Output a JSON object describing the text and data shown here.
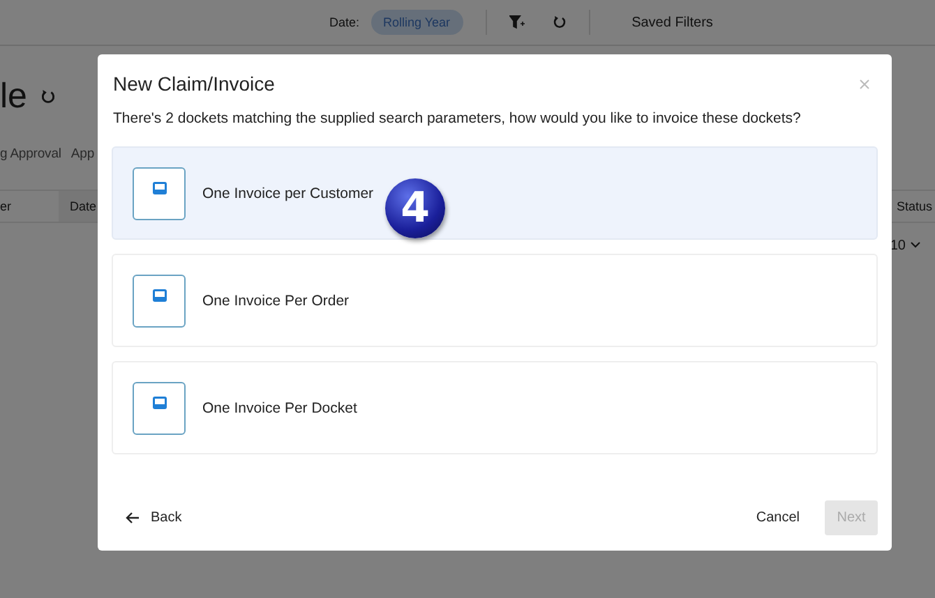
{
  "background": {
    "filter_bar": {
      "date_label": "Date:",
      "date_value": "Rolling Year",
      "saved_filters": "Saved Filters"
    },
    "page_title": "le",
    "tabs": [
      "g Approval",
      "App"
    ],
    "table": {
      "columns": [
        "er",
        "Date",
        "Status"
      ],
      "page_size": "10"
    }
  },
  "dialog": {
    "title": "New Claim/Invoice",
    "message": "There's 2 dockets matching the supplied search parameters, how would you like to invoice these dockets?",
    "options": [
      {
        "label": "One Invoice per Customer",
        "selected": true
      },
      {
        "label": "One Invoice Per Order",
        "selected": false
      },
      {
        "label": "One Invoice Per Docket",
        "selected": false
      }
    ],
    "step_badge": "4",
    "buttons": {
      "back": "Back",
      "cancel": "Cancel",
      "next": "Next",
      "next_disabled": true
    }
  }
}
